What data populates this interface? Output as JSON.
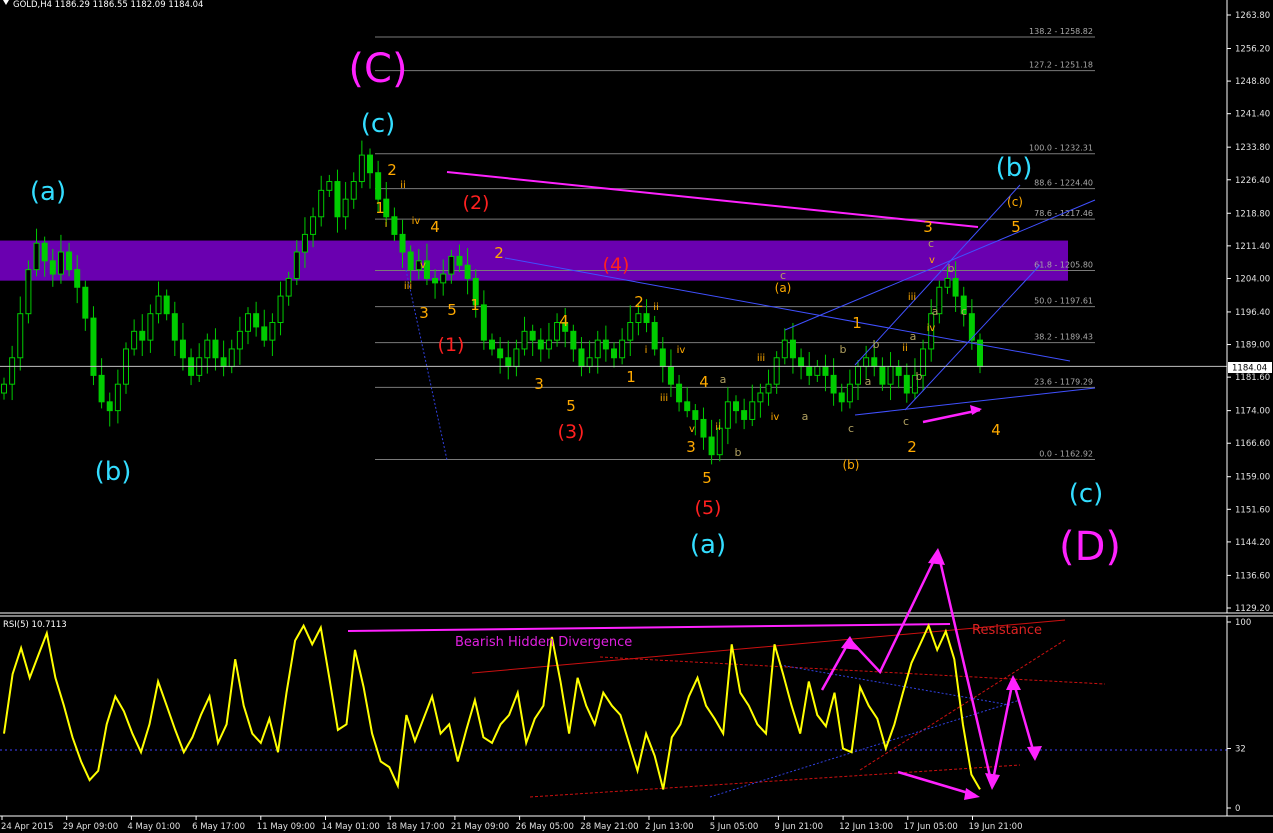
{
  "price_panel": {
    "header": "GOLD,H4  1186.29 1186.55 1182.09 1184.04",
    "current_price": "1184.04"
  },
  "rsi_panel": {
    "header": "RSI(5) 10.7113"
  },
  "colors": {
    "background": "#000000",
    "candle": "#00cc00",
    "rsi_line": "#ffff00",
    "zone": "#6a00b0",
    "magenta": "#ff00ff",
    "cyan": "#33ddff",
    "orange": "#ffaa00",
    "red": "#ff2020",
    "trend_blue": "#5060ff"
  },
  "chart_data": [
    {
      "type": "candlestick",
      "title": "GOLD,H4",
      "series": [
        {
          "name": "GOLD H4 close (approx.)",
          "values": [
            1180,
            1186,
            1196,
            1206,
            1212,
            1208,
            1205,
            1210,
            1206,
            1202,
            1195,
            1182,
            1176,
            1174,
            1180,
            1188,
            1192,
            1190,
            1196,
            1200,
            1196,
            1190,
            1186,
            1182,
            1186,
            1190,
            1186,
            1184,
            1188,
            1192,
            1196,
            1193,
            1190,
            1194,
            1200,
            1204,
            1210,
            1214,
            1218,
            1224,
            1226,
            1218,
            1222,
            1226,
            1232,
            1228,
            1222,
            1218,
            1214,
            1210,
            1206,
            1208,
            1204,
            1203,
            1205,
            1209,
            1207,
            1204,
            1198,
            1190,
            1188,
            1186,
            1184,
            1188,
            1192,
            1190,
            1188,
            1190,
            1194,
            1192,
            1188,
            1184,
            1186,
            1190,
            1188,
            1186,
            1190,
            1194,
            1196,
            1194,
            1188,
            1184,
            1180,
            1176,
            1174,
            1172,
            1168,
            1164,
            1170,
            1176,
            1174,
            1172,
            1176,
            1178,
            1180,
            1186,
            1190,
            1186,
            1184,
            1182,
            1184,
            1182,
            1178,
            1176,
            1180,
            1184,
            1186,
            1184,
            1180,
            1184,
            1182,
            1178,
            1182,
            1188,
            1196,
            1202,
            1204,
            1200,
            1196,
            1190,
            1184
          ]
        }
      ],
      "ylim": [
        1126,
        1266
      ],
      "y_ticks": [
        "1263.80",
        "1256.20",
        "1248.80",
        "1241.40",
        "1233.80",
        "1226.40",
        "1218.80",
        "1211.40",
        "1204.00",
        "1196.40",
        "1189.00",
        "1181.60",
        "1174.00",
        "1166.60",
        "1159.00",
        "1151.60",
        "1144.20",
        "1136.60",
        "1129.20"
      ],
      "x_ticks": [
        "24 Apr 2015",
        "29 Apr 09:00",
        "4 May 01:00",
        "6 May 17:00",
        "11 May 09:00",
        "14 May 01:00",
        "18 May 17:00",
        "21 May 09:00",
        "26 May 05:00",
        "28 May 21:00",
        "2 Jun 13:00",
        "5 Jun 05:00",
        "9 Jun 21:00",
        "12 Jun 13:00",
        "17 Jun 05:00",
        "19 Jun 21:00"
      ],
      "fibonacci_levels": [
        {
          "label": "138.2 - 1258.82",
          "price": 1258.82
        },
        {
          "label": "127.2 - 1251.18",
          "price": 1251.18
        },
        {
          "label": "100.0 - 1232.31",
          "price": 1232.31
        },
        {
          "label": "88.6 - 1224.40",
          "price": 1224.4
        },
        {
          "label": "78.6 - 1217.46",
          "price": 1217.46
        },
        {
          "label": "61.8 - 1205.80",
          "price": 1205.8
        },
        {
          "label": "50.0 - 1197.61",
          "price": 1197.61
        },
        {
          "label": "38.2 - 1189.43",
          "price": 1189.43
        },
        {
          "label": "23.6 - 1179.29",
          "price": 1179.29
        },
        {
          "label": "0.0 - 1162.92",
          "price": 1162.92
        }
      ],
      "resistance_zone": {
        "from": 1203.5,
        "to": 1212.6
      },
      "wave_labels": [
        {
          "text": "(C)",
          "color": "magenta",
          "size": "xl"
        },
        {
          "text": "(c)",
          "color": "cyan",
          "size": "l"
        },
        {
          "text": "(a)",
          "color": "cyan",
          "size": "l"
        },
        {
          "text": "(b)",
          "color": "cyan",
          "size": "l"
        },
        {
          "text": "(b)",
          "color": "cyan",
          "size": "l"
        },
        {
          "text": "(c)",
          "color": "cyan",
          "size": "l"
        },
        {
          "text": "(a)",
          "color": "cyan",
          "size": "l"
        },
        {
          "text": "(D)",
          "color": "magenta",
          "size": "xl"
        },
        {
          "text": "(1)",
          "color": "red",
          "size": "m"
        },
        {
          "text": "(2)",
          "color": "red",
          "size": "m"
        },
        {
          "text": "(3)",
          "color": "red",
          "size": "m"
        },
        {
          "text": "(4)",
          "color": "red",
          "size": "m"
        },
        {
          "text": "(5)",
          "color": "red",
          "size": "m"
        },
        {
          "text": "(a)",
          "color": "orange",
          "size": "s"
        },
        {
          "text": "(b)",
          "color": "orange",
          "size": "s"
        },
        {
          "text": "(c)",
          "color": "orange",
          "size": "s"
        },
        {
          "text": "1",
          "color": "orange",
          "size": "s"
        },
        {
          "text": "2",
          "color": "orange",
          "size": "s"
        },
        {
          "text": "4",
          "color": "orange",
          "size": "s"
        },
        {
          "text": "3",
          "color": "orange",
          "size": "s"
        },
        {
          "text": "5",
          "color": "orange",
          "size": "s"
        },
        {
          "text": "1",
          "color": "orange",
          "size": "s"
        },
        {
          "text": "2",
          "color": "orange",
          "size": "s"
        },
        {
          "text": "3",
          "color": "orange",
          "size": "s"
        },
        {
          "text": "4",
          "color": "orange",
          "size": "s"
        },
        {
          "text": "5",
          "color": "orange",
          "size": "s"
        },
        {
          "text": "1",
          "color": "orange",
          "size": "s"
        },
        {
          "text": "2",
          "color": "orange",
          "size": "s"
        },
        {
          "text": "4",
          "color": "orange",
          "size": "s"
        },
        {
          "text": "3",
          "color": "orange",
          "size": "s"
        },
        {
          "text": "5",
          "color": "orange",
          "size": "s"
        },
        {
          "text": "1",
          "color": "orange",
          "size": "s"
        },
        {
          "text": "2",
          "color": "orange",
          "size": "s"
        },
        {
          "text": "3",
          "color": "orange",
          "size": "s"
        },
        {
          "text": "4",
          "color": "orange",
          "size": "s"
        },
        {
          "text": "5",
          "color": "orange",
          "size": "s"
        },
        {
          "text": "i",
          "color": "orange",
          "size": "xs"
        },
        {
          "text": "ii",
          "color": "orange",
          "size": "xs"
        },
        {
          "text": "iii",
          "color": "orange",
          "size": "xs"
        },
        {
          "text": "iv",
          "color": "orange",
          "size": "xs"
        },
        {
          "text": "v",
          "color": "orange",
          "size": "xs"
        },
        {
          "text": "ii",
          "color": "orange",
          "size": "xs"
        },
        {
          "text": "i",
          "color": "orange",
          "size": "xs"
        },
        {
          "text": "iii",
          "color": "orange",
          "size": "xs"
        },
        {
          "text": "iv",
          "color": "orange",
          "size": "xs"
        },
        {
          "text": "v",
          "color": "orange",
          "size": "xs"
        },
        {
          "text": "ii",
          "color": "orange",
          "size": "xs"
        },
        {
          "text": "iii",
          "color": "orange",
          "size": "xs"
        },
        {
          "text": "iv",
          "color": "orange",
          "size": "xs"
        },
        {
          "text": "ii",
          "color": "orange",
          "size": "xs"
        },
        {
          "text": "iii",
          "color": "orange",
          "size": "xs"
        },
        {
          "text": "iv",
          "color": "orange",
          "size": "xs"
        },
        {
          "text": "v",
          "color": "orange",
          "size": "xs"
        },
        {
          "text": "a",
          "color": "olive",
          "size": "xs"
        },
        {
          "text": "b",
          "color": "olive",
          "size": "xs"
        },
        {
          "text": "c",
          "color": "olive",
          "size": "xs"
        },
        {
          "text": "a",
          "color": "olive",
          "size": "xs"
        },
        {
          "text": "b",
          "color": "olive",
          "size": "xs"
        },
        {
          "text": "c",
          "color": "olive",
          "size": "xs"
        },
        {
          "text": "a",
          "color": "olive",
          "size": "xs"
        },
        {
          "text": "b",
          "color": "olive",
          "size": "xs"
        },
        {
          "text": "c",
          "color": "olive",
          "size": "xs"
        },
        {
          "text": "a",
          "color": "olive",
          "size": "xs"
        },
        {
          "text": "b",
          "color": "olive",
          "size": "xs"
        },
        {
          "text": "c",
          "color": "olive",
          "size": "xs"
        },
        {
          "text": "a",
          "color": "olive",
          "size": "xs"
        },
        {
          "text": "b",
          "color": "olive",
          "size": "xs"
        },
        {
          "text": "c",
          "color": "olive",
          "size": "xs"
        }
      ]
    },
    {
      "type": "line",
      "title": "RSI(5) 10.7113",
      "series": [
        {
          "name": "RSI(5)",
          "values": [
            40,
            72,
            86,
            70,
            82,
            94,
            70,
            55,
            38,
            25,
            15,
            20,
            45,
            60,
            52,
            40,
            30,
            45,
            68,
            55,
            42,
            30,
            38,
            50,
            60,
            35,
            45,
            80,
            55,
            40,
            35,
            48,
            30,
            62,
            90,
            98,
            88,
            97,
            70,
            42,
            45,
            85,
            65,
            40,
            25,
            22,
            12,
            50,
            36,
            48,
            60,
            40,
            45,
            25,
            42,
            58,
            38,
            35,
            45,
            50,
            62,
            35,
            48,
            55,
            92,
            68,
            40,
            70,
            55,
            45,
            62,
            55,
            50,
            35,
            20,
            40,
            28,
            10,
            38,
            45,
            60,
            70,
            55,
            48,
            40,
            88,
            62,
            55,
            45,
            40,
            88,
            72,
            55,
            40,
            68,
            50,
            44,
            62,
            32,
            30,
            65,
            55,
            48,
            32,
            45,
            62,
            78,
            88,
            98,
            85,
            95,
            80,
            45,
            18,
            10
          ]
        }
      ],
      "ylim": [
        0,
        100
      ],
      "y_ticks": [
        "100",
        "32",
        "0"
      ],
      "annotations": [
        "Bearish Hidden Divergence",
        "Resistance"
      ]
    }
  ]
}
